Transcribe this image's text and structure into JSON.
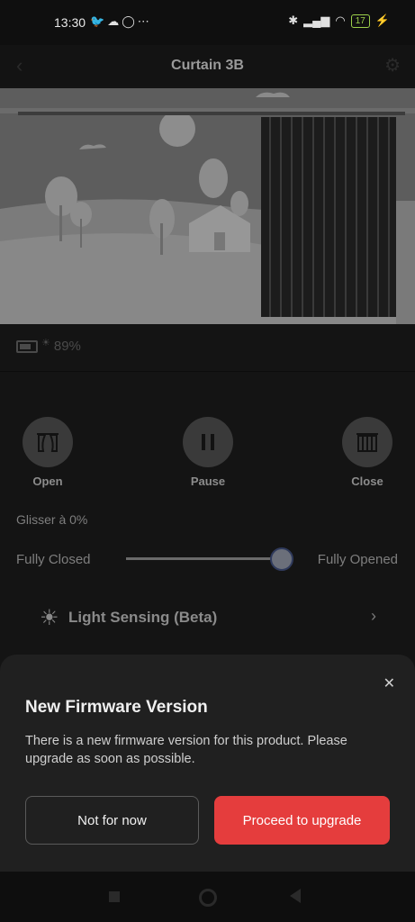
{
  "status_bar": {
    "time": "13:30",
    "left_icons": [
      "twitter-icon",
      "cloud-icon",
      "circle-icon",
      "more-icon"
    ],
    "right_icons": [
      "bluetooth-icon",
      "signal-icon",
      "wifi-icon",
      "battery-icon",
      "charging-icon"
    ],
    "battery_level": "17"
  },
  "header": {
    "title": "Curtain 3B"
  },
  "device": {
    "battery_percent": "89%"
  },
  "controls": {
    "open_label": "Open",
    "pause_label": "Pause",
    "close_label": "Close"
  },
  "slide": {
    "label": "Glisser à 0%",
    "min_label": "Fully Closed",
    "max_label": "Fully Opened",
    "position_fraction": 0.99
  },
  "light_sensing": {
    "label": "Light Sensing (Beta)"
  },
  "modal": {
    "title": "New Firmware Version",
    "message": "There is a new firmware version for this product. Please upgrade as soon as possible.",
    "dismiss_label": "Not for now",
    "confirm_label": "Proceed to upgrade",
    "confirm_color": "#e53d3d"
  }
}
